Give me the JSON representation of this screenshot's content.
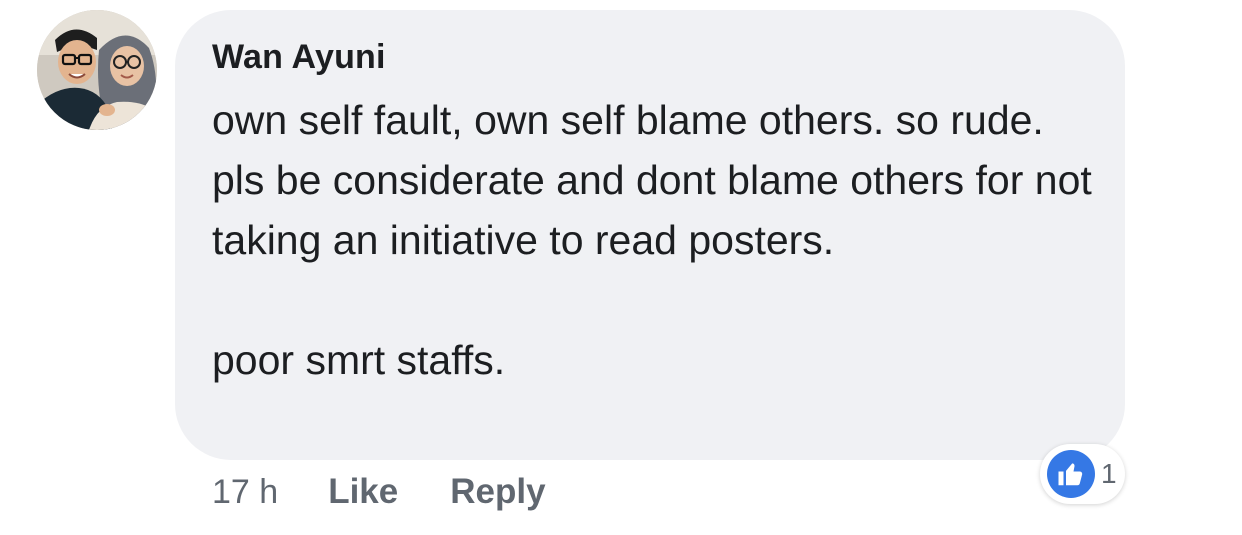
{
  "comment": {
    "author": "Wan Ayuni",
    "paragraphs": [
      "own self fault, own self blame others. so rude. pls be considerate and dont blame others for not taking an initiative to read posters.",
      "poor smrt staffs."
    ],
    "timestamp": "17 h",
    "actions": {
      "like_label": "Like",
      "reply_label": "Reply"
    },
    "reactions": {
      "icon": "thumbs-up-icon",
      "count": "1",
      "color": "#3578e5"
    },
    "avatar_icon": "profile-photo"
  },
  "colors": {
    "bubble_background": "#f0f1f4",
    "primary_text": "#1c1e21",
    "secondary_text": "#606770",
    "like_blue": "#3578e5"
  }
}
